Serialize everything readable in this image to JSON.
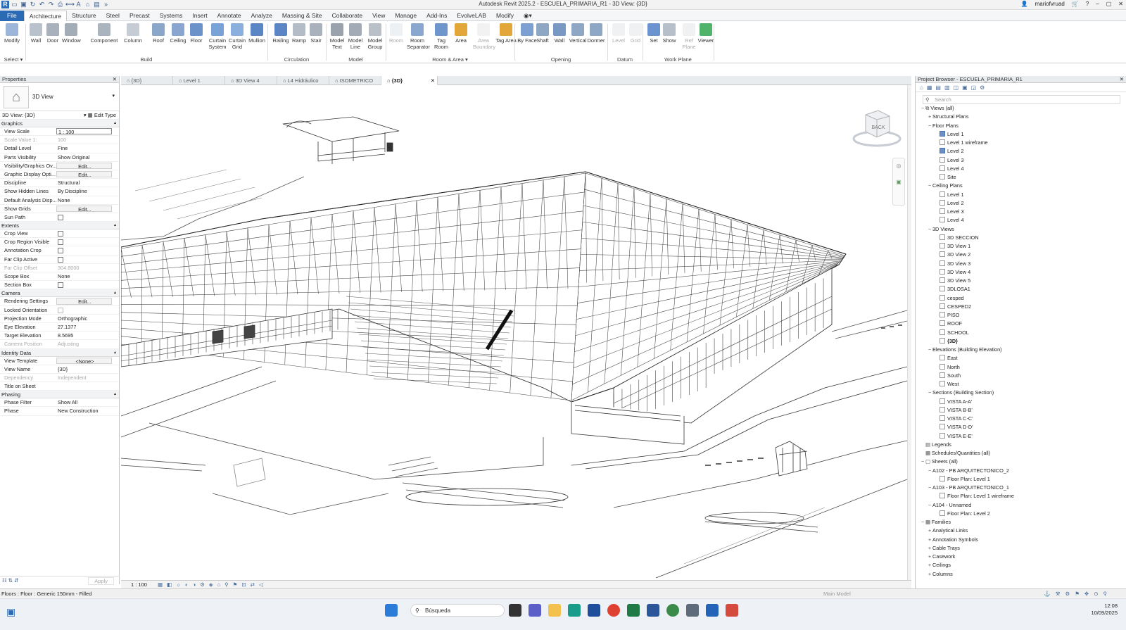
{
  "title": "Autodesk Revit 2025.2 - ESCUELA_PRIMARIA_R1 - 3D View: {3D}",
  "user": "mariofvruad",
  "menu_tabs": [
    "File",
    "Architecture",
    "Structure",
    "Steel",
    "Precast",
    "Systems",
    "Insert",
    "Annotate",
    "Analyze",
    "Massing & Site",
    "Collaborate",
    "View",
    "Manage",
    "Add-Ins",
    "EvolveLAB",
    "Modify"
  ],
  "ribbon": {
    "buttons": [
      {
        "label": "Modify",
        "color": "#9bb6d9"
      },
      {
        "label": "Wall",
        "color": "#b9c2cc"
      },
      {
        "label": "Door",
        "color": "#a9b2bc"
      },
      {
        "label": "Window",
        "color": "#a3adb8"
      },
      {
        "label": "Component",
        "color": "#aab4bf"
      },
      {
        "label": "Column",
        "color": "#c6ccd3"
      },
      {
        "label": "Roof",
        "color": "#8aa6c9"
      },
      {
        "label": "Ceiling",
        "color": "#88a6cf"
      },
      {
        "label": "Floor",
        "color": "#6c93c9"
      },
      {
        "label": "Curtain System",
        "color": "#79a3d6"
      },
      {
        "label": "Curtain Grid",
        "color": "#8cb0de"
      },
      {
        "label": "Mullion",
        "color": "#5b86c5"
      },
      {
        "label": "Railing",
        "color": "#5b86c5"
      },
      {
        "label": "Ramp",
        "color": "#b3bcc7"
      },
      {
        "label": "Stair",
        "color": "#a8b1bc"
      },
      {
        "label": "Model Text",
        "color": "#9aa3ad"
      },
      {
        "label": "Model Line",
        "color": "#a3acb6"
      },
      {
        "label": "Model Group",
        "color": "#b9c0c8"
      },
      {
        "label": "Room",
        "color": "#cfd6de"
      },
      {
        "label": "Room Separator",
        "color": "#8aa8cf"
      },
      {
        "label": "Tag Room",
        "color": "#6f96cc"
      },
      {
        "label": "Area",
        "color": "#e3a63a"
      },
      {
        "label": "Area Boundary",
        "color": "#d9d9d9"
      },
      {
        "label": "Tag Area",
        "color": "#e3a63a"
      },
      {
        "label": "By Face",
        "color": "#7ca0d2"
      },
      {
        "label": "Shaft",
        "color": "#8ea7c4"
      },
      {
        "label": "Wall",
        "color": "#7899c4"
      },
      {
        "label": "Vertical",
        "color": "#8ea7c4"
      },
      {
        "label": "Dormer",
        "color": "#8ea7c4"
      },
      {
        "label": "Level",
        "color": "#d3d8de"
      },
      {
        "label": "Grid",
        "color": "#d3d8de"
      },
      {
        "label": "Set",
        "color": "#6b93cf"
      },
      {
        "label": "Show",
        "color": "#b7c0ca"
      },
      {
        "label": "Ref Plane",
        "color": "#d3d8de"
      },
      {
        "label": "Viewer",
        "color": "#4fb36a"
      }
    ],
    "groups": [
      "Select",
      "Build",
      "Circulation",
      "Model",
      "Room & Area",
      "Opening",
      "Datum",
      "Work Plane"
    ]
  },
  "properties": {
    "header": "Properties",
    "type_name": "3D View",
    "instance": "3D View: {3D}",
    "edit_type": "Edit Type",
    "groups": [
      {
        "name": "Graphics",
        "rows": [
          {
            "k": "View Scale",
            "v": "1 : 100",
            "style": "box"
          },
          {
            "k": "Scale Value    1:",
            "v": "100",
            "style": "dis"
          },
          {
            "k": "Detail Level",
            "v": "Fine"
          },
          {
            "k": "Parts Visibility",
            "v": "Show Original"
          },
          {
            "k": "Visibility/Graphics Ov...",
            "v": "Edit...",
            "style": "btn"
          },
          {
            "k": "Graphic Display Opti...",
            "v": "Edit...",
            "style": "btn"
          },
          {
            "k": "Discipline",
            "v": "Structural"
          },
          {
            "k": "Show Hidden Lines",
            "v": "By Discipline"
          },
          {
            "k": "Default Analysis Disp...",
            "v": "None"
          },
          {
            "k": "Show Grids",
            "v": "Edit...",
            "style": "btn"
          },
          {
            "k": "Sun Path",
            "v": "",
            "style": "chk"
          }
        ]
      },
      {
        "name": "Extents",
        "rows": [
          {
            "k": "Crop View",
            "v": "",
            "style": "chk"
          },
          {
            "k": "Crop Region Visible",
            "v": "",
            "style": "chk"
          },
          {
            "k": "Annotation Crop",
            "v": "",
            "style": "chk"
          },
          {
            "k": "Far Clip Active",
            "v": "",
            "style": "chk"
          },
          {
            "k": "Far Clip Offset",
            "v": "304.8000",
            "style": "dis"
          },
          {
            "k": "Scope Box",
            "v": "None"
          },
          {
            "k": "Section Box",
            "v": "",
            "style": "chk"
          }
        ]
      },
      {
        "name": "Camera",
        "rows": [
          {
            "k": "Rendering Settings",
            "v": "Edit...",
            "style": "btn"
          },
          {
            "k": "Locked Orientation",
            "v": "",
            "style": "chkdis"
          },
          {
            "k": "Projection Mode",
            "v": "Orthographic"
          },
          {
            "k": "Eye Elevation",
            "v": "27.1377"
          },
          {
            "k": "Target Elevation",
            "v": "8.5695"
          },
          {
            "k": "Camera Position",
            "v": "Adjusting",
            "style": "dis"
          }
        ]
      },
      {
        "name": "Identity Data",
        "rows": [
          {
            "k": "View Template",
            "v": "<None>",
            "style": "btn"
          },
          {
            "k": "View Name",
            "v": "{3D}"
          },
          {
            "k": "Dependency",
            "v": "Independent",
            "style": "dis"
          },
          {
            "k": "Title on Sheet",
            "v": ""
          }
        ]
      },
      {
        "name": "Phasing",
        "rows": [
          {
            "k": "Phase Filter",
            "v": "Show All"
          },
          {
            "k": "Phase",
            "v": "New Construction"
          }
        ]
      }
    ],
    "apply": "Apply"
  },
  "view_tabs": [
    {
      "label": "{3D}",
      "active": false
    },
    {
      "label": "Level 1",
      "active": false
    },
    {
      "label": "3D View 4",
      "active": false
    },
    {
      "label": "L4 Hidráulico",
      "active": false
    },
    {
      "label": "ISOMETRICO",
      "active": false
    },
    {
      "label": "{3D}",
      "active": true
    }
  ],
  "viewcube_face": "BACK",
  "view_scale": "1 : 100",
  "project_browser": {
    "header": "Project Browser - ESCUELA_PRIMARIA_R1",
    "search_placeholder": "Search",
    "nodes": [
      {
        "d": 0,
        "t": "-",
        "label": "Views (all)",
        "icon": "views"
      },
      {
        "d": 1,
        "t": "+",
        "label": "Structural Plans"
      },
      {
        "d": 1,
        "t": "-",
        "label": "Floor Plans"
      },
      {
        "d": 2,
        "label": "Level 1",
        "sel": true
      },
      {
        "d": 2,
        "label": "Level 1 wireframe"
      },
      {
        "d": 2,
        "label": "Level 2",
        "sel": true
      },
      {
        "d": 2,
        "label": "Level 3"
      },
      {
        "d": 2,
        "label": "Level 4"
      },
      {
        "d": 2,
        "label": "Site"
      },
      {
        "d": 1,
        "t": "-",
        "label": "Ceiling Plans"
      },
      {
        "d": 2,
        "label": "Level 1"
      },
      {
        "d": 2,
        "label": "Level 2"
      },
      {
        "d": 2,
        "label": "Level 3"
      },
      {
        "d": 2,
        "label": "Level 4"
      },
      {
        "d": 1,
        "t": "-",
        "label": "3D Views"
      },
      {
        "d": 2,
        "label": "3D SECCION"
      },
      {
        "d": 2,
        "label": "3D View 1"
      },
      {
        "d": 2,
        "label": "3D View 2"
      },
      {
        "d": 2,
        "label": "3D View 3"
      },
      {
        "d": 2,
        "label": "3D View 4"
      },
      {
        "d": 2,
        "label": "3D View 5"
      },
      {
        "d": 2,
        "label": "3DLOSA1"
      },
      {
        "d": 2,
        "label": "cesped"
      },
      {
        "d": 2,
        "label": "CESPED2"
      },
      {
        "d": 2,
        "label": "PISO"
      },
      {
        "d": 2,
        "label": "ROOF"
      },
      {
        "d": 2,
        "label": "SCHOOL"
      },
      {
        "d": 2,
        "label": "{3D}",
        "bold": true
      },
      {
        "d": 1,
        "t": "-",
        "label": "Elevations (Building Elevation)"
      },
      {
        "d": 2,
        "label": "East"
      },
      {
        "d": 2,
        "label": "North"
      },
      {
        "d": 2,
        "label": "South"
      },
      {
        "d": 2,
        "label": "West"
      },
      {
        "d": 1,
        "t": "-",
        "label": "Sections (Building Section)"
      },
      {
        "d": 2,
        "label": "VISTA A-A'"
      },
      {
        "d": 2,
        "label": "VISTA B-B'"
      },
      {
        "d": 2,
        "label": "VISTA C-C'"
      },
      {
        "d": 2,
        "label": "VISTA D-D'"
      },
      {
        "d": 2,
        "label": "VISTA E-E'"
      },
      {
        "d": 0,
        "label": "Legends",
        "icon": "legend"
      },
      {
        "d": 0,
        "label": "Schedules/Quantities (all)",
        "icon": "sched"
      },
      {
        "d": 0,
        "t": "-",
        "label": "Sheets (all)",
        "icon": "sheet"
      },
      {
        "d": 1,
        "t": "-",
        "label": "A102 - PB ARQUITECTONICO_2"
      },
      {
        "d": 2,
        "label": "Floor Plan: Level 1"
      },
      {
        "d": 1,
        "t": "-",
        "label": "A103 - PB ARQUITECTONICO_1"
      },
      {
        "d": 2,
        "label": "Floor Plan: Level 1 wireframe"
      },
      {
        "d": 1,
        "t": "-",
        "label": "A104 - Unnamed"
      },
      {
        "d": 2,
        "label": "Floor Plan: Level 2"
      },
      {
        "d": 0,
        "t": "-",
        "label": "Families",
        "icon": "fam"
      },
      {
        "d": 1,
        "t": "+",
        "label": "Analytical Links"
      },
      {
        "d": 1,
        "t": "+",
        "label": "Annotation Symbols"
      },
      {
        "d": 1,
        "t": "+",
        "label": "Cable Trays"
      },
      {
        "d": 1,
        "t": "+",
        "label": "Casework"
      },
      {
        "d": 1,
        "t": "+",
        "label": "Ceilings"
      },
      {
        "d": 1,
        "t": "+",
        "label": "Columns"
      }
    ]
  },
  "statusbar": {
    "left": "Floors : Floor : Generic 150mm - Filled",
    "model": "Main Model"
  },
  "taskbar": {
    "search": "Búsqueda",
    "time": "12:08",
    "date": "10/09/2025"
  }
}
